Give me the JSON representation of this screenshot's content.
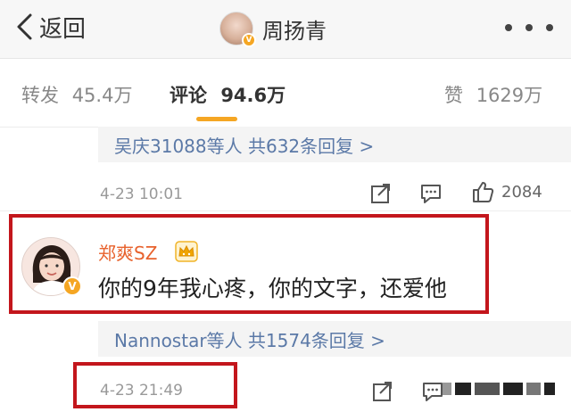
{
  "nav": {
    "back_label": "返回",
    "title": "周扬青"
  },
  "tabs": [
    {
      "label": "转发",
      "count": "45.4万",
      "active": false
    },
    {
      "label": "评论",
      "count": "94.6万",
      "active": true
    },
    {
      "label": "赞",
      "count": "1629万",
      "active": false
    }
  ],
  "colors": {
    "accent": "#f5a623",
    "link": "#5b79a7",
    "username": "#e8622d",
    "highlight": "#c3161c"
  },
  "thread_above": {
    "replies_summary": "吴庆31088等人  共632条回复 >",
    "time": "4-23 10:01",
    "like_count": "2084",
    "icons": [
      "share-icon",
      "comment-icon",
      "like-icon"
    ]
  },
  "comment": {
    "username": "郑爽SZ",
    "verified_badge": "V",
    "text": "你的9年我心疼，你的文字，还爱他",
    "replies_summary": "Nannostar等人  共1574条回复 >",
    "time": "4-23 21:49",
    "icons": [
      "share-icon",
      "comment-icon"
    ]
  }
}
